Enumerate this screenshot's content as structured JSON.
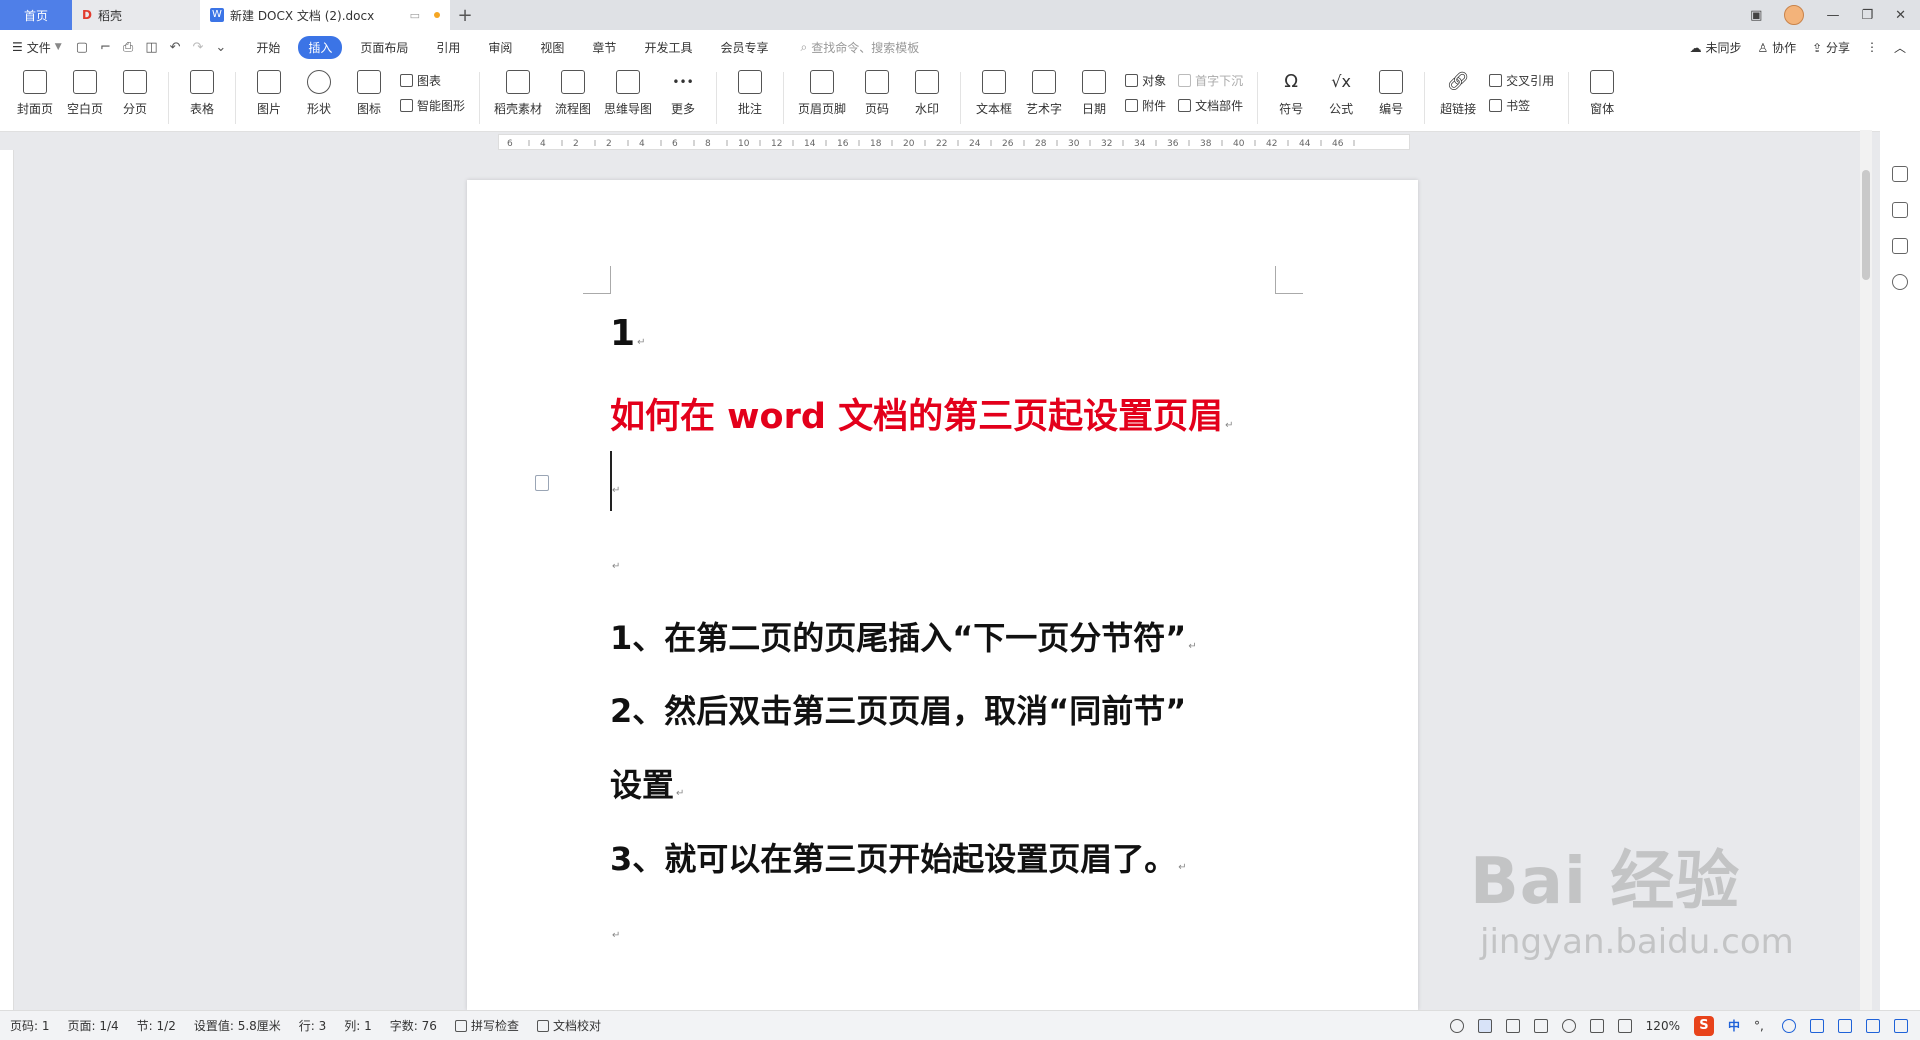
{
  "tabs": {
    "home": "首页",
    "daoke": "稻壳",
    "doc": "新建 DOCX 文档 (2).docx"
  },
  "menubar": {
    "file": "文件",
    "items": [
      "开始",
      "插入",
      "页面布局",
      "引用",
      "审阅",
      "视图",
      "章节",
      "开发工具",
      "会员专享"
    ],
    "active": "插入",
    "search_placeholder": "查找命令、搜索模板",
    "sync": "未同步",
    "collab": "协作",
    "share": "分享"
  },
  "ribbon": {
    "cover": "封面页",
    "blank": "空白页",
    "pagebreak": "分页",
    "table": "表格",
    "picture": "图片",
    "shape": "形状",
    "icon": "图标",
    "chart": "图表",
    "smartart": "智能图形",
    "material": "稻壳素材",
    "flowchart": "流程图",
    "mindmap": "思维导图",
    "more": "更多",
    "comment": "批注",
    "header_footer": "页眉页脚",
    "page_number": "页码",
    "watermark": "水印",
    "textbox": "文本框",
    "wordart": "艺术字",
    "date": "日期",
    "object": "对象",
    "attachment": "附件",
    "dropcap": "首字下沉",
    "docparts": "文档部件",
    "symbol": "符号",
    "formula": "公式",
    "numbering": "编号",
    "hyperlink": "超链接",
    "crossref": "交叉引用",
    "bookmark": "书签",
    "window": "窗体"
  },
  "ruler_ticks": [
    "6",
    "4",
    "2",
    "2",
    "4",
    "6",
    "8",
    "10",
    "12",
    "14",
    "16",
    "18",
    "20",
    "22",
    "24",
    "26",
    "28",
    "30",
    "32",
    "34",
    "36",
    "38",
    "40",
    "42",
    "44",
    "46"
  ],
  "document": {
    "line_number": "1",
    "title": "如何在 word 文档的第三页起设置页眉",
    "step1": "1、在第二页的页尾插入“下一页分节符”",
    "step2a": "2、然后双击第三页页眉，取消“同前节”",
    "step2b": "设置",
    "step3": "3、就可以在第三页开始起设置页眉了。",
    "para_mark": "↵",
    "title_color": "#e3001b"
  },
  "statusbar": {
    "page_code": "页码: 1",
    "page": "页面: 1/4",
    "section": "节: 1/2",
    "setting": "设置值: 5.8厘米",
    "row": "行: 3",
    "col": "列: 1",
    "wordcount": "字数: 76",
    "spellcheck": "拼写检查",
    "proofread": "文档校对",
    "zoom": "120%",
    "ime_label": "中"
  },
  "watermark": {
    "big": "Bai 经验",
    "small": "jingyan.baidu.com"
  },
  "colors": {
    "accent": "#3b74e6",
    "home_tab": "#4f7fe8"
  }
}
